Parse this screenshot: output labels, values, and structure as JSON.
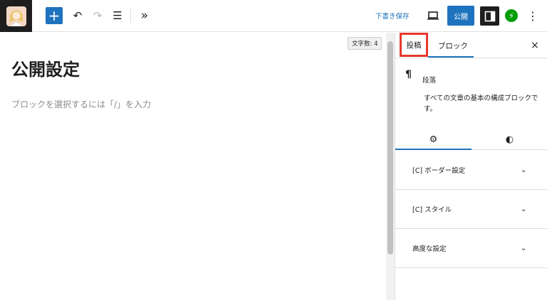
{
  "toolbar": {
    "add_icon": "+",
    "undo_icon": "↶",
    "redo_icon": "↷",
    "outline_icon": "☰",
    "more_tools_icon": "»",
    "save_draft": "下書き保存",
    "preview_icon": "▭",
    "publish": "公開",
    "jetpack_icon": "⚡",
    "kebab_icon": "⋮"
  },
  "editor": {
    "word_count": "文字数: 4",
    "title": "公開設定",
    "placeholder": "ブロックを選択するには「/」を入力"
  },
  "sidebar": {
    "tabs": [
      "投稿",
      "ブロック"
    ],
    "close_icon": "×",
    "block": {
      "icon": "¶",
      "name": "段落",
      "description": "すべての文章の基本の構成ブロックです。"
    },
    "style_tabs": {
      "settings_icon": "⚙",
      "styles_icon": "◐"
    },
    "panels": [
      {
        "label": "[C] ボーダー設定"
      },
      {
        "label": "[C] スタイル"
      },
      {
        "label": "高度な設定"
      }
    ],
    "chevron_icon": "⌄"
  },
  "colors": {
    "accent": "#1e73be",
    "highlight": "#e8382b",
    "jetpack": "#069e08"
  }
}
